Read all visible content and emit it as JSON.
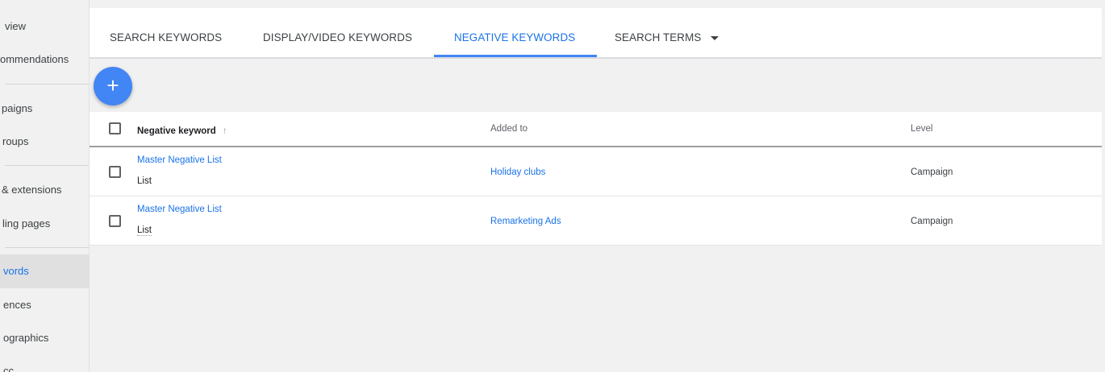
{
  "sidebar": {
    "items": [
      {
        "label": "view"
      },
      {
        "label": "ommendations"
      },
      {
        "label": "paigns"
      },
      {
        "label": "roups"
      },
      {
        "label": "& extensions"
      },
      {
        "label": "ling pages"
      },
      {
        "label": "vords"
      },
      {
        "label": "ences"
      },
      {
        "label": "ographics"
      },
      {
        "label": "cc"
      }
    ]
  },
  "tabs": [
    {
      "label": "SEARCH KEYWORDS"
    },
    {
      "label": "DISPLAY/VIDEO KEYWORDS"
    },
    {
      "label": "NEGATIVE KEYWORDS"
    },
    {
      "label": "SEARCH TERMS"
    }
  ],
  "fab": {
    "label": "+"
  },
  "table": {
    "columns": {
      "keyword": "Negative keyword",
      "added_to": "Added to",
      "level": "Level"
    },
    "sort_icon": "↑",
    "rows": [
      {
        "keyword": "Master Negative List",
        "type": "List",
        "added_to": "Holiday clubs",
        "level": "Campaign"
      },
      {
        "keyword": "Master Negative List",
        "type": "List",
        "added_to": "Remarketing Ads",
        "level": "Campaign"
      }
    ]
  },
  "colors": {
    "accent": "#4285f4",
    "link": "#1a73e8"
  },
  "icons": {
    "fab": "plus-icon",
    "tab_dropdown": "caret-down-icon",
    "sort": "sort-arrow-up-icon"
  }
}
